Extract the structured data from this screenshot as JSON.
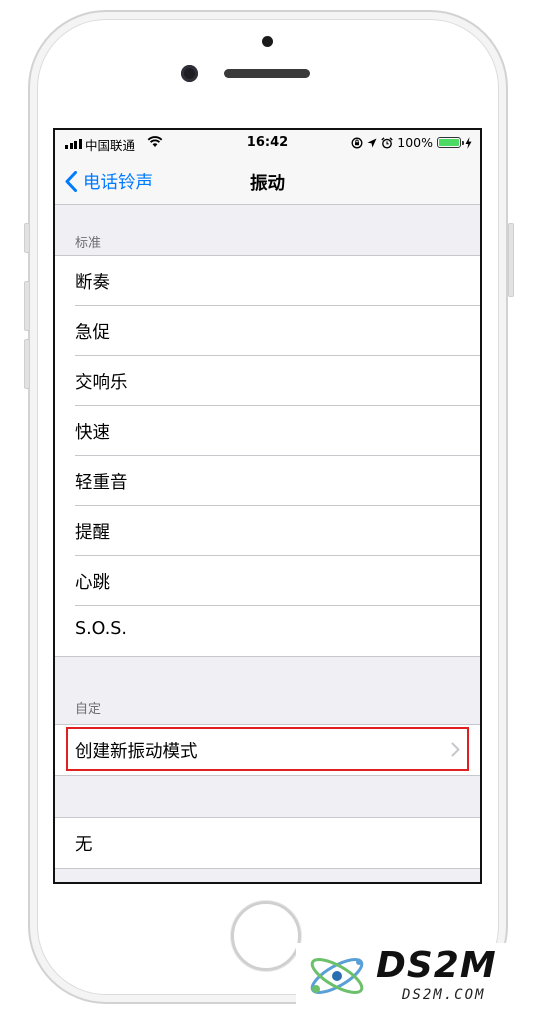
{
  "status": {
    "carrier": "中国联通",
    "time": "16:42",
    "battery_percent": "100%",
    "battery_level": 1.0
  },
  "nav": {
    "back_label": "电话铃声",
    "title": "振动"
  },
  "standard": {
    "header": "标准",
    "items": [
      {
        "label": "断奏"
      },
      {
        "label": "急促"
      },
      {
        "label": "交响乐"
      },
      {
        "label": "快速"
      },
      {
        "label": "轻重音"
      },
      {
        "label": "提醒"
      },
      {
        "label": "心跳"
      },
      {
        "label": "S.O.S."
      }
    ]
  },
  "custom": {
    "header": "自定",
    "create_label": "创建新振动模式"
  },
  "none": {
    "label": "无"
  },
  "colors": {
    "accent": "#007aff",
    "highlight_box": "#e02020",
    "battery": "#4cd964",
    "group_background": "#efeff4"
  },
  "watermark": {
    "brand": "DS2M",
    "domain": "DS2M.COM"
  }
}
